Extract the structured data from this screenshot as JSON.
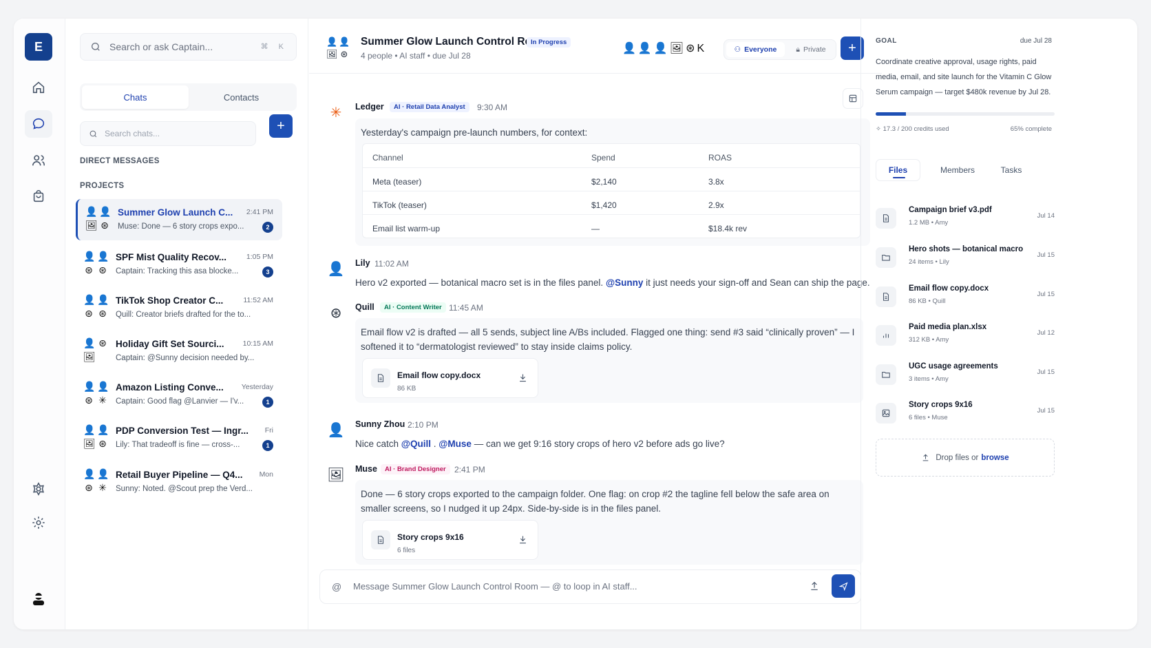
{
  "rail": {
    "logo": "E"
  },
  "left": {
    "search": {
      "placeholder": "Search or ask Captain...",
      "shortcut": "⌘ K"
    },
    "tabs": [
      "Chats",
      "Contacts"
    ],
    "chat_search_placeholder": "Search chats...",
    "add": "+",
    "sections": {
      "dm": "DIRECT MESSAGES",
      "projects": "PROJECTS"
    },
    "chats": [
      {
        "title": "Summer Glow Launch C...",
        "time": "2:41 PM",
        "sub": "Muse: Done — 6 story crops expo...",
        "badge": "2",
        "avatars": [
          "👤",
          "👤",
          "🖼",
          "⊛"
        ]
      },
      {
        "title": "SPF Mist Quality Recov...",
        "time": "1:05 PM",
        "sub": "Captain: Tracking this asa blocke...",
        "badge": "3",
        "avatars": [
          "👤",
          "👤",
          "⊛",
          "⊛"
        ]
      },
      {
        "title": "TikTok Shop Creator C...",
        "time": "11:52 AM",
        "sub": "Quill: Creator briefs drafted for the to...",
        "badge": "",
        "avatars": [
          "👤",
          "👤",
          "⊛",
          "⊛"
        ]
      },
      {
        "title": "Holiday Gift Set Sourci...",
        "time": "10:15 AM",
        "sub": "Captain: @Sunny decision needed by...",
        "badge": "",
        "avatars": [
          "👤",
          "⊛",
          "🖼",
          ""
        ]
      },
      {
        "title": "Amazon Listing Conve...",
        "time": "Yesterday",
        "sub": "Captain: Good flag @Lanvier — I'v...",
        "badge": "1",
        "avatars": [
          "👤",
          "👤",
          "⊛",
          "✳"
        ]
      },
      {
        "title": "PDP Conversion Test — Ingr...",
        "time": "Fri",
        "sub": "Lily: That tradeoff is fine — cross-...",
        "badge": "1",
        "avatars": [
          "👤",
          "👤",
          "🖼",
          "⊛"
        ]
      },
      {
        "title": "Retail Buyer Pipeline — Q4...",
        "time": "Mon",
        "sub": "Sunny: Noted. @Scout prep the Verd...",
        "badge": "",
        "avatars": [
          "👤",
          "👤",
          "⊛",
          "✳"
        ]
      }
    ]
  },
  "header": {
    "title": "Summer Glow Launch Control Room",
    "status": "In Progress",
    "subtitle": "4 people • AI staff • due Jul 28",
    "members": "👤👤👤🖼⊛K",
    "visibility": [
      "Everyone",
      "Private"
    ],
    "add": "+"
  },
  "messages": {
    "ledger": {
      "name": "Ledger",
      "tag": "AI · Retail Data Analyst",
      "time": "9:30 AM",
      "text": "Yesterday's campaign pre-launch numbers, for context:",
      "table": {
        "headers": [
          "Channel",
          "Spend",
          "ROAS"
        ],
        "rows": [
          [
            "Meta (teaser)",
            "$2,140",
            "3.8x"
          ],
          [
            "TikTok (teaser)",
            "$1,420",
            "2.9x"
          ],
          [
            "Email list warm-up",
            "—",
            "$18.4k rev"
          ]
        ]
      }
    },
    "lily": {
      "name": "Lily",
      "time": "11:02 AM",
      "text_a": "Hero v2 exported — botanical macro set is in the files panel.",
      "mention": "@Sunny",
      "text_b": "it just needs your sign-off and Sean can ship the page."
    },
    "quill": {
      "name": "Quill",
      "tag": "AI · Content Writer",
      "time": "11:45 AM",
      "text": "Email flow v2 is drafted — all 5 sends, subject line A/Bs included. Flagged one thing: send #3 said “clinically proven” — I softened it to “dermatologist reviewed” to stay inside claims policy.",
      "file": {
        "name": "Email flow copy.docx",
        "meta": "86 KB"
      }
    },
    "sunny": {
      "name": "Sunny Zhou",
      "time": "2:10 PM",
      "text_a": "Nice catch",
      "mention1": "@Quill",
      "sep": ".",
      "mention2": "@Muse",
      "text_b": "— can we get 9:16 story crops of hero v2 before ads go live?"
    },
    "muse": {
      "name": "Muse",
      "tag": "AI · Brand Designer",
      "time": "2:41 PM",
      "text": "Done — 6 story crops exported to the campaign folder. One flag: on crop #2 the tagline fell below the safe area on smaller screens, so I nudged it up 24px. Side-by-side is in the files panel.",
      "file": {
        "name": "Story crops 9x16",
        "meta": "6 files"
      }
    }
  },
  "composer": {
    "at": "@",
    "placeholder": "Message Summer Glow Launch Control Room — @ to loop in AI staff..."
  },
  "goal": {
    "label": "GOAL",
    "due": "due Jul 28",
    "text": "Coordinate creative approval, usage rights, paid media, email, and site launch for the Vitamin C Glow Serum campaign — target $480k revenue by Jul 28.",
    "credits": "✧ 17.3 / 200 credits used",
    "complete": "65% complete",
    "progress_fraction": 0.17
  },
  "right_tabs": [
    "Files",
    "Members",
    "Tasks"
  ],
  "files": [
    {
      "name": "Campaign brief v3.pdf",
      "meta": "1.2 MB • Amy",
      "date": "Jul 14",
      "icon": "doc-icon"
    },
    {
      "name": "Hero shots — botanical macro",
      "meta": "24 items • Lily",
      "date": "Jul 15",
      "icon": "folder-icon"
    },
    {
      "name": "Email flow copy.docx",
      "meta": "86 KB • Quill",
      "date": "Jul 15",
      "icon": "doc-icon"
    },
    {
      "name": "Paid media plan.xlsx",
      "meta": "312 KB • Amy",
      "date": "Jul 12",
      "icon": "chart-icon"
    },
    {
      "name": "UGC usage agreements",
      "meta": "3 items • Amy",
      "date": "Jul 15",
      "icon": "folder-icon"
    },
    {
      "name": "Story crops 9x16",
      "meta": "6 files • Muse",
      "date": "Jul 15",
      "icon": "image-icon"
    }
  ],
  "drop": {
    "text": "Drop files or",
    "link": "browse"
  }
}
